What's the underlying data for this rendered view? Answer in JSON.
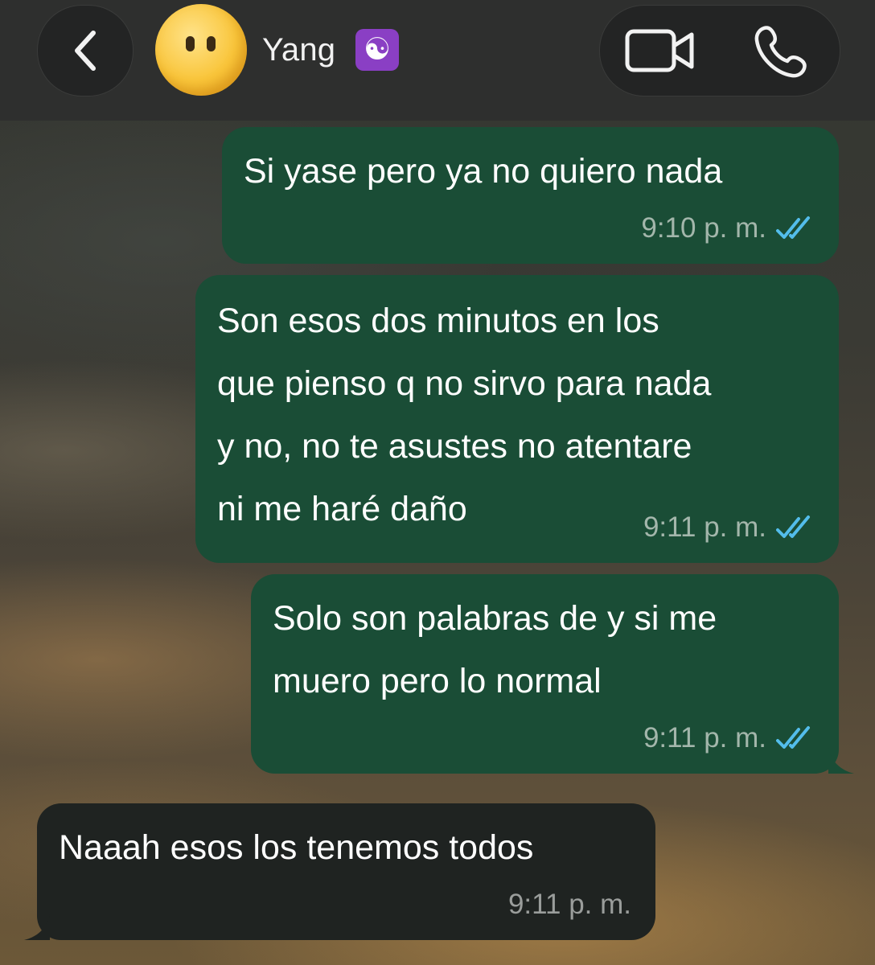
{
  "header": {
    "contact_name": "Yang",
    "badge_symbol": "☯",
    "avatar_emoji": "face-without-mouth"
  },
  "colors": {
    "outgoing_bubble": "#1a4d36",
    "incoming_bubble": "#1f2321",
    "read_ticks": "#53bdeb",
    "badge": "#8a3fc4"
  },
  "messages": [
    {
      "direction": "outgoing",
      "text": "Si yase pero ya no quiero nada",
      "time": "9:10 p. m.",
      "status": "read"
    },
    {
      "direction": "outgoing",
      "text": "Son esos dos minutos en los\nque pienso q no sirvo para nada\ny no, no te asustes no atentare\nni me haré daño",
      "time": "9:11 p. m.",
      "status": "read"
    },
    {
      "direction": "outgoing",
      "text": "Solo son palabras de y si me\nmuero pero lo normal",
      "time": "9:11 p. m.",
      "status": "read"
    },
    {
      "direction": "incoming",
      "text": "Naaah esos los tenemos todos",
      "time": "9:11 p. m."
    }
  ]
}
